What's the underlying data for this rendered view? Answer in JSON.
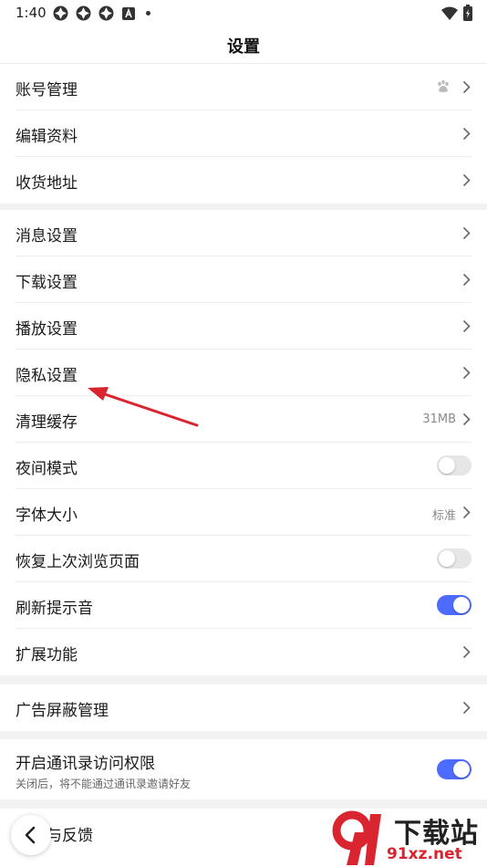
{
  "status_bar": {
    "time": "1:40"
  },
  "header": {
    "title": "设置"
  },
  "groups": [
    {
      "rows": [
        {
          "label": "账号管理"
        },
        {
          "label": "编辑资料"
        },
        {
          "label": "收货地址"
        }
      ]
    },
    {
      "rows": [
        {
          "label": "消息设置"
        },
        {
          "label": "下载设置"
        },
        {
          "label": "播放设置"
        },
        {
          "label": "隐私设置"
        },
        {
          "label": "清理缓存",
          "value": "31MB"
        },
        {
          "label": "夜间模式",
          "toggle": false
        },
        {
          "label": "字体大小",
          "value": "标准"
        },
        {
          "label": "恢复上次浏览页面",
          "toggle": false
        },
        {
          "label": "刷新提示音",
          "toggle": true
        },
        {
          "label": "扩展功能"
        }
      ]
    },
    {
      "rows": [
        {
          "label": "广告屏蔽管理"
        }
      ]
    },
    {
      "rows": [
        {
          "label": "开启通讯录访问权限",
          "sublabel": "关闭后，将不能通过通讯录邀请好友",
          "toggle": true
        }
      ]
    },
    {
      "rows": [
        {
          "label": "帮助与反馈"
        }
      ]
    }
  ],
  "watermark": {
    "brand": "下载站",
    "url": "91xz.net"
  },
  "colors": {
    "accent": "#4d6bfe",
    "annotation_arrow": "#d9252f",
    "background": "#f2f2f2"
  }
}
